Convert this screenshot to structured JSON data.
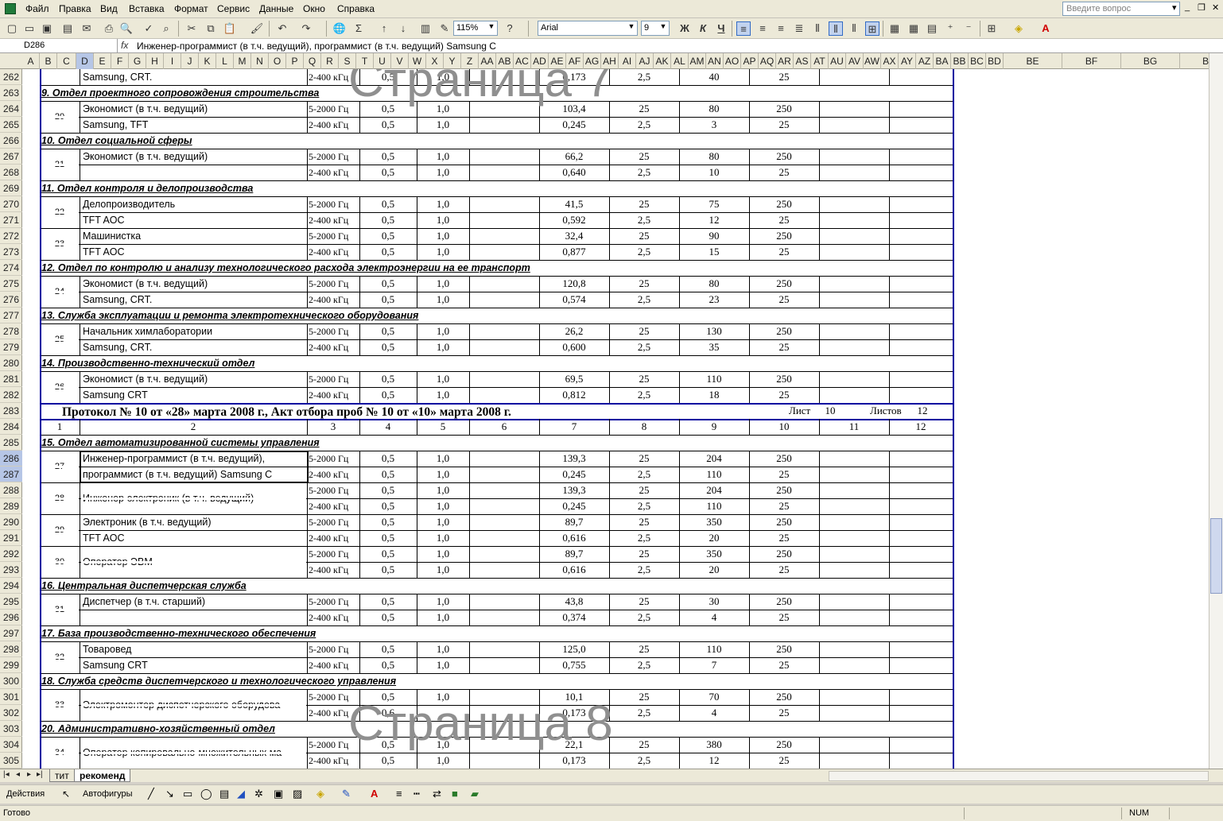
{
  "menu": [
    "Файл",
    "Правка",
    "Вид",
    "Вставка",
    "Формат",
    "Сервис",
    "Данные",
    "Окно",
    "Справка"
  ],
  "question_placeholder": "Введите вопрос",
  "toolbar": {
    "zoom": "115%",
    "font_name": "Arial",
    "font_size": "9",
    "bold": "Ж",
    "italic": "К",
    "underline": "Ч"
  },
  "name_box": "D286",
  "formula": "Инженер-программист (в т.ч. ведущий), программист (в т.ч. ведущий) Samsung C",
  "columns": [
    "A",
    "B",
    "C",
    "D",
    "E",
    "F",
    "G",
    "H",
    "I",
    "J",
    "K",
    "L",
    "M",
    "N",
    "O",
    "P",
    "Q",
    "R",
    "S",
    "T",
    "U",
    "V",
    "W",
    "X",
    "Y",
    "Z",
    "AA",
    "AB",
    "AC",
    "AD",
    "AE",
    "AF",
    "AG",
    "AH",
    "AI",
    "AJ",
    "AK",
    "AL",
    "AM",
    "AN",
    "AO",
    "AP",
    "AQ",
    "AR",
    "AS",
    "AT",
    "AU",
    "AV",
    "AW",
    "AX",
    "AY",
    "AZ",
    "BA",
    "BB",
    "BC",
    "BD",
    "BE",
    "BF",
    "BG",
    "BH"
  ],
  "row_numbers": [
    "262",
    "263",
    "264",
    "265",
    "266",
    "267",
    "268",
    "269",
    "270",
    "271",
    "272",
    "273",
    "274",
    "275",
    "276",
    "277",
    "278",
    "279",
    "280",
    "281",
    "282",
    "283",
    "284",
    "285",
    "286",
    "287",
    "288",
    "289",
    "290",
    "291",
    "292",
    "293",
    "294",
    "295",
    "296",
    "297",
    "298",
    "299",
    "300",
    "301",
    "302",
    "303",
    "304",
    "305"
  ],
  "watermarks": {
    "page7": "Страница 7",
    "page8": "Страница 8"
  },
  "sections": {
    "s263": "9. Отдел проектного сопровождения строительства",
    "s266": "10. Отдел социальной сферы",
    "s269": "11. Отдел контроля и делопроизводства",
    "s274": "12. Отдел по контролю и анализу технологического расхода электроэнергии на ее транспорт",
    "s277": "13. Служба эксплуатации и ремонта электротехнического оборудования",
    "s280": "14. Производственно-технический отдел",
    "s285": "15. Отдел автоматизированной системы управления",
    "s294": "16. Центральная диспетчерская служба",
    "s297": "17. База производственно-технического обеспечения",
    "s300": "18. Служба средств диспетчерского и технологического управления",
    "s303": "20. Административно-хозяйственный отдел"
  },
  "protocol": {
    "title": "Протокол № 10 от «28» марта 2008 г., Акт отбора проб № 10 от «10» марта 2008 г.",
    "list_label": "Лист",
    "list_value": "10",
    "lists_label": "Листов",
    "lists_value": "12"
  },
  "col_numbers": [
    "1",
    "2",
    "3",
    "4",
    "5",
    "6",
    "7",
    "8",
    "9",
    "10",
    "11",
    "12"
  ],
  "rows": [
    {
      "r": "262",
      "n": "",
      "name": "Samsung, CRT.",
      "f": "2-400 кГц",
      "a": "0,5",
      "b": "1,0",
      "m": "0,173",
      "p": "2,5",
      "q": "40",
      "s": "25"
    },
    {
      "r": "264",
      "n": "20",
      "name": "Экономист (в т.ч. ведущий)",
      "f": "5-2000 Гц",
      "a": "0,5",
      "b": "1,0",
      "m": "103,4",
      "p": "25",
      "q": "80",
      "s": "250"
    },
    {
      "r": "265",
      "n": "",
      "name": "Samsung, TFT",
      "f": "2-400 кГц",
      "a": "0,5",
      "b": "1,0",
      "m": "0,245",
      "p": "2,5",
      "q": "3",
      "s": "25"
    },
    {
      "r": "267",
      "n": "21",
      "name": "Экономист (в т.ч. ведущий)",
      "f": "5-2000 Гц",
      "a": "0,5",
      "b": "1,0",
      "m": "66,2",
      "p": "25",
      "q": "80",
      "s": "250"
    },
    {
      "r": "268",
      "n": "",
      "name": "",
      "f": "2-400 кГц",
      "a": "0,5",
      "b": "1,0",
      "m": "0,640",
      "p": "2,5",
      "q": "10",
      "s": "25"
    },
    {
      "r": "270",
      "n": "22",
      "name": "Делопроизводитель",
      "f": "5-2000 Гц",
      "a": "0,5",
      "b": "1,0",
      "m": "41,5",
      "p": "25",
      "q": "75",
      "s": "250"
    },
    {
      "r": "271",
      "n": "",
      "name": "TFT AOC",
      "f": "2-400 кГц",
      "a": "0,5",
      "b": "1,0",
      "m": "0,592",
      "p": "2,5",
      "q": "12",
      "s": "25"
    },
    {
      "r": "272",
      "n": "23",
      "name": "Машинистка",
      "f": "5-2000 Гц",
      "a": "0,5",
      "b": "1,0",
      "m": "32,4",
      "p": "25",
      "q": "90",
      "s": "250"
    },
    {
      "r": "273",
      "n": "",
      "name": "TFT AOC",
      "f": "2-400 кГц",
      "a": "0,5",
      "b": "1,0",
      "m": "0,877",
      "p": "2,5",
      "q": "15",
      "s": "25"
    },
    {
      "r": "275",
      "n": "24",
      "name": "Экономист (в т.ч. ведущий)",
      "f": "5-2000 Гц",
      "a": "0,5",
      "b": "1,0",
      "m": "120,8",
      "p": "25",
      "q": "80",
      "s": "250"
    },
    {
      "r": "276",
      "n": "",
      "name": "Samsung, CRT.",
      "f": "2-400 кГц",
      "a": "0,5",
      "b": "1,0",
      "m": "0,574",
      "p": "2,5",
      "q": "23",
      "s": "25"
    },
    {
      "r": "278",
      "n": "25",
      "name": "Начальник химлаборатории",
      "f": "5-2000 Гц",
      "a": "0,5",
      "b": "1,0",
      "m": "26,2",
      "p": "25",
      "q": "130",
      "s": "250"
    },
    {
      "r": "279",
      "n": "",
      "name": "Samsung, CRT.",
      "f": "2-400 кГц",
      "a": "0,5",
      "b": "1,0",
      "m": "0,600",
      "p": "2,5",
      "q": "35",
      "s": "25"
    },
    {
      "r": "281",
      "n": "26",
      "name": "Экономист (в т.ч. ведущий)",
      "f": "5-2000 Гц",
      "a": "0,5",
      "b": "1,0",
      "m": "69,5",
      "p": "25",
      "q": "110",
      "s": "250"
    },
    {
      "r": "282",
      "n": "",
      "name": "Samsung CRT",
      "f": "2-400 кГц",
      "a": "0,5",
      "b": "1,0",
      "m": "0,812",
      "p": "2,5",
      "q": "18",
      "s": "25"
    },
    {
      "r": "286",
      "n": "27",
      "name": "Инженер-программист (в т.ч. ведущий),",
      "f": "5-2000 Гц",
      "a": "0,5",
      "b": "1,0",
      "m": "139,3",
      "p": "25",
      "q": "204",
      "s": "250"
    },
    {
      "r": "287",
      "n": "",
      "name": "программист (в т.ч. ведущий) Samsung C",
      "f": "2-400 кГц",
      "a": "0,5",
      "b": "1,0",
      "m": "0,245",
      "p": "2,5",
      "q": "110",
      "s": "25"
    },
    {
      "r": "288",
      "n": "28",
      "name": "",
      "f": "5-2000 Гц",
      "a": "0,5",
      "b": "1,0",
      "m": "139,3",
      "p": "25",
      "q": "204",
      "s": "250"
    },
    {
      "r": "289",
      "n": "",
      "name": "",
      "f": "2-400 кГц",
      "a": "0,5",
      "b": "1,0",
      "m": "0,245",
      "p": "2,5",
      "q": "110",
      "s": "25"
    },
    {
      "r": "290",
      "n": "29",
      "name": "Электроник (в т.ч. ведущий)",
      "f": "5-2000 Гц",
      "a": "0,5",
      "b": "1,0",
      "m": "89,7",
      "p": "25",
      "q": "350",
      "s": "250"
    },
    {
      "r": "291",
      "n": "",
      "name": "TFT AOC",
      "f": "2-400 кГц",
      "a": "0,5",
      "b": "1,0",
      "m": "0,616",
      "p": "2,5",
      "q": "20",
      "s": "25"
    },
    {
      "r": "292",
      "n": "30",
      "name": "",
      "f": "5-2000 Гц",
      "a": "0,5",
      "b": "1,0",
      "m": "89,7",
      "p": "25",
      "q": "350",
      "s": "250"
    },
    {
      "r": "293",
      "n": "",
      "name": "",
      "f": "2-400 кГц",
      "a": "0,5",
      "b": "1,0",
      "m": "0,616",
      "p": "2,5",
      "q": "20",
      "s": "25"
    },
    {
      "r": "295",
      "n": "31",
      "name": "Диспетчер (в т.ч. старший)",
      "f": "5-2000 Гц",
      "a": "0,5",
      "b": "1,0",
      "m": "43,8",
      "p": "25",
      "q": "30",
      "s": "250"
    },
    {
      "r": "296",
      "n": "",
      "name": "",
      "f": "2-400 кГц",
      "a": "0,5",
      "b": "1,0",
      "m": "0,374",
      "p": "2,5",
      "q": "4",
      "s": "25"
    },
    {
      "r": "298",
      "n": "32",
      "name": "Товаровед",
      "f": "5-2000 Гц",
      "a": "0,5",
      "b": "1,0",
      "m": "125,0",
      "p": "25",
      "q": "110",
      "s": "250"
    },
    {
      "r": "299",
      "n": "",
      "name": "Samsung CRT",
      "f": "2-400 кГц",
      "a": "0,5",
      "b": "1,0",
      "m": "0,755",
      "p": "2,5",
      "q": "7",
      "s": "25"
    },
    {
      "r": "301",
      "n": "33",
      "name": "",
      "f": "5-2000 Гц",
      "a": "0,5",
      "b": "1,0",
      "m": "10,1",
      "p": "25",
      "q": "70",
      "s": "250"
    },
    {
      "r": "302",
      "n": "",
      "name": "",
      "f": "2-400 кГц",
      "a": "0,6",
      "b": "",
      "m": "0,173",
      "p": "2,5",
      "q": "4",
      "s": "25"
    },
    {
      "r": "304",
      "n": "34",
      "name": "",
      "f": "5-2000 Гц",
      "a": "0,5",
      "b": "1,0",
      "m": "22,1",
      "p": "25",
      "q": "380",
      "s": "250"
    },
    {
      "r": "305",
      "n": "",
      "name": "",
      "f": "2-400 кГц",
      "a": "0,5",
      "b": "1,0",
      "m": "0,173",
      "p": "2,5",
      "q": "12",
      "s": "25"
    }
  ],
  "merged_names": {
    "r288": "Инженер-электроник (в т.ч. ведущий)",
    "r292": "Оператор ЭВМ",
    "r301": "Электромонтер диспетчерского оборудова",
    "r304": "Оператор копировально-множительных ма"
  },
  "sheet_tabs": [
    "тит",
    "рекоменд"
  ],
  "drawbar": {
    "actions": "Действия",
    "autoshapes": "Автофигуры"
  },
  "status": {
    "ready": "Готово",
    "num": "NUM"
  }
}
